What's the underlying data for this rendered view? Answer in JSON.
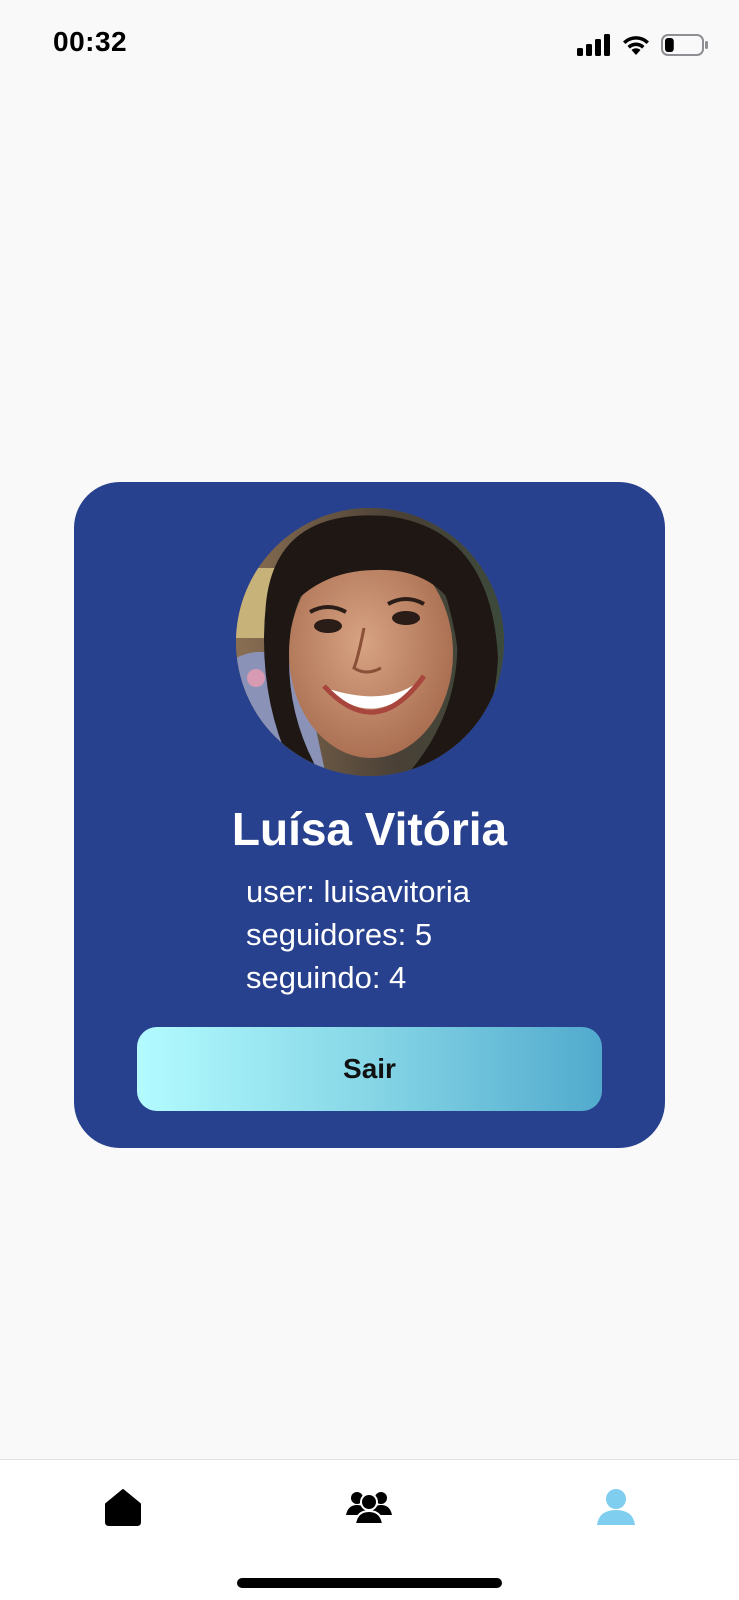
{
  "status_bar": {
    "time": "00:32",
    "battery_level": 0.25
  },
  "profile": {
    "name": "Luísa Vitória",
    "user_line": "user: luisavitoria",
    "followers_line": "seguidores: 5",
    "following_line": "seguindo: 4",
    "logout_label": "Sair"
  },
  "colors": {
    "card_bg": "#28418e",
    "button_gradient": [
      "#b3fbff",
      "#51aacd"
    ],
    "active_tab": "#7fcef0",
    "inactive_tab": "#000000"
  },
  "tab_bar": {
    "tabs": [
      {
        "icon": "home-icon",
        "active": false
      },
      {
        "icon": "friends-icon",
        "active": false
      },
      {
        "icon": "profile-icon",
        "active": true
      }
    ]
  }
}
